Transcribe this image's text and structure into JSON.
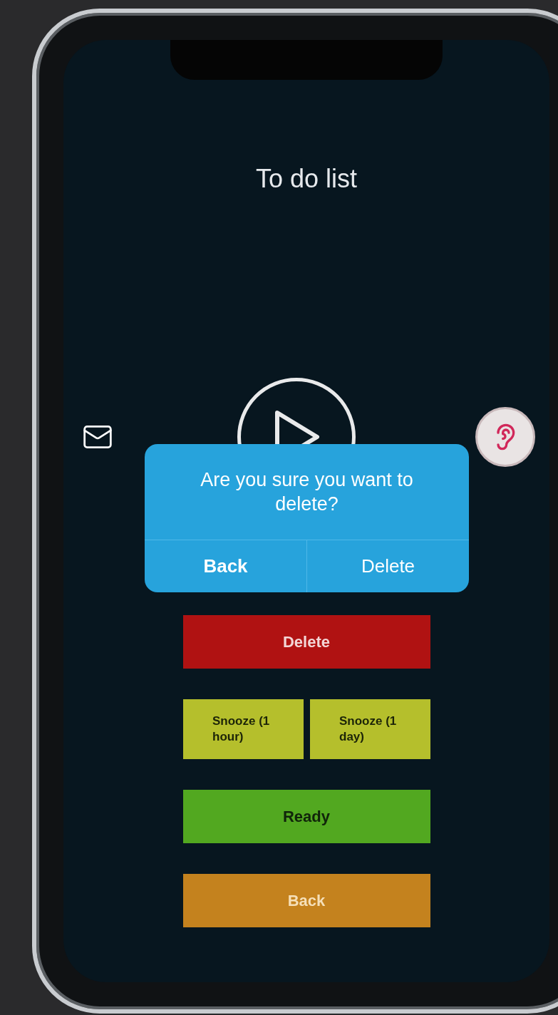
{
  "screen": {
    "title": "To do list"
  },
  "dialog": {
    "message": "Are you sure you want to delete?",
    "buttons": [
      {
        "label": "Back",
        "kind": "cancel"
      },
      {
        "label": "Delete",
        "kind": "confirm"
      }
    ]
  },
  "actions": [
    {
      "kind": "delete",
      "label": "Delete"
    },
    {
      "kind": "snooze",
      "buttons": [
        {
          "label": "Snooze (1 hour)"
        },
        {
          "label": "Snooze (1 day)"
        }
      ]
    },
    {
      "kind": "ready",
      "label": "Ready"
    },
    {
      "kind": "back",
      "label": "Back"
    }
  ]
}
